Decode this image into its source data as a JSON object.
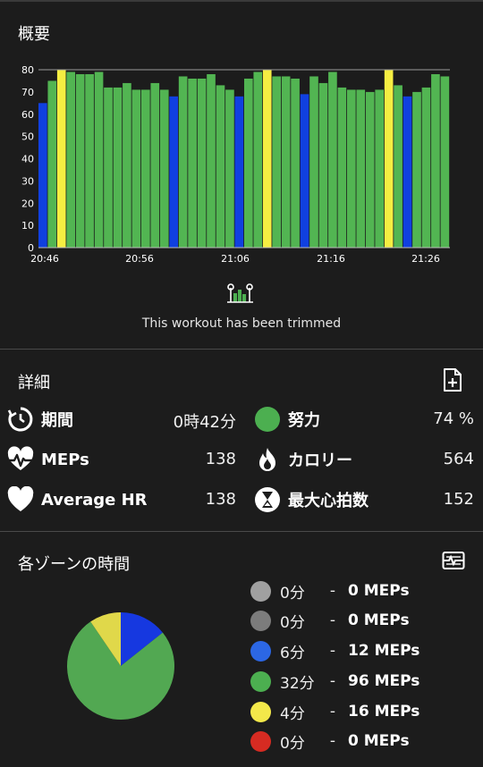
{
  "overview": {
    "title": "概要",
    "trim_text": "This workout has been trimmed"
  },
  "details": {
    "title": "詳細",
    "stats": [
      {
        "label": "期間",
        "value": "0時42分",
        "icon": "clock-refresh-icon"
      },
      {
        "label": "努力",
        "value": "74 %",
        "icon": "green-circle-icon"
      },
      {
        "label": "MEPs",
        "value": "138",
        "icon": "heart-pulse-icon"
      },
      {
        "label": "カロリー",
        "value": "564",
        "icon": "flame-icon"
      },
      {
        "label": "Average HR",
        "value": "138",
        "icon": "heart-icon"
      },
      {
        "label": "最大心拍数",
        "value": "152",
        "icon": "hourglass-icon"
      }
    ]
  },
  "zones": {
    "title": "各ゾーンの時間",
    "items": [
      {
        "minutes": "0分",
        "sep": "-",
        "meps": "0 MEPs",
        "color": "#a0a0a0"
      },
      {
        "minutes": "0分",
        "sep": "-",
        "meps": "0 MEPs",
        "color": "#7c7c7c"
      },
      {
        "minutes": "6分",
        "sep": "-",
        "meps": "12 MEPs",
        "color": "#2c67e4"
      },
      {
        "minutes": "32分",
        "sep": "-",
        "meps": "96 MEPs",
        "color": "#4caf50"
      },
      {
        "minutes": "4分",
        "sep": "-",
        "meps": "16 MEPs",
        "color": "#f3e84a"
      },
      {
        "minutes": "0分",
        "sep": "-",
        "meps": "0 MEPs",
        "color": "#d62b22"
      }
    ]
  },
  "colors": {
    "blue": "#1040e0",
    "green": "#52b552",
    "yellow": "#f5ee42",
    "text": "#ffffff",
    "background": "#1c1c1c"
  },
  "chart_data": [
    {
      "type": "bar",
      "title": "",
      "xlabel": "",
      "ylabel": "",
      "ylim": [
        0,
        80
      ],
      "y_ticks": [
        "0",
        "10",
        "20",
        "30",
        "40",
        "50",
        "60",
        "70",
        "80"
      ],
      "x_ticks": [
        "20:46",
        "20:56",
        "21:06",
        "21:16",
        "21:26"
      ],
      "grid": false,
      "values": [
        65,
        75,
        80,
        79,
        78,
        78,
        79,
        72,
        72,
        74,
        71,
        71,
        74,
        71,
        68,
        77,
        76,
        76,
        78,
        73,
        71,
        68,
        76,
        79,
        80,
        77,
        77,
        76,
        69,
        77,
        74,
        79,
        72,
        71,
        71,
        70,
        71,
        80,
        73,
        68,
        70,
        72,
        78,
        77
      ],
      "zones": [
        "b",
        "g",
        "y",
        "g",
        "g",
        "g",
        "g",
        "g",
        "g",
        "g",
        "g",
        "g",
        "g",
        "g",
        "b",
        "g",
        "g",
        "g",
        "g",
        "g",
        "g",
        "b",
        "g",
        "g",
        "y",
        "g",
        "g",
        "g",
        "b",
        "g",
        "g",
        "g",
        "g",
        "g",
        "g",
        "g",
        "g",
        "y",
        "g",
        "b",
        "g",
        "g",
        "g",
        "g"
      ]
    },
    {
      "type": "pie",
      "labels": [
        "6分",
        "32分",
        "4分"
      ],
      "values": [
        6,
        32,
        4
      ],
      "colors": [
        "#1638e0",
        "#52a852",
        "#e0d84a"
      ]
    }
  ]
}
